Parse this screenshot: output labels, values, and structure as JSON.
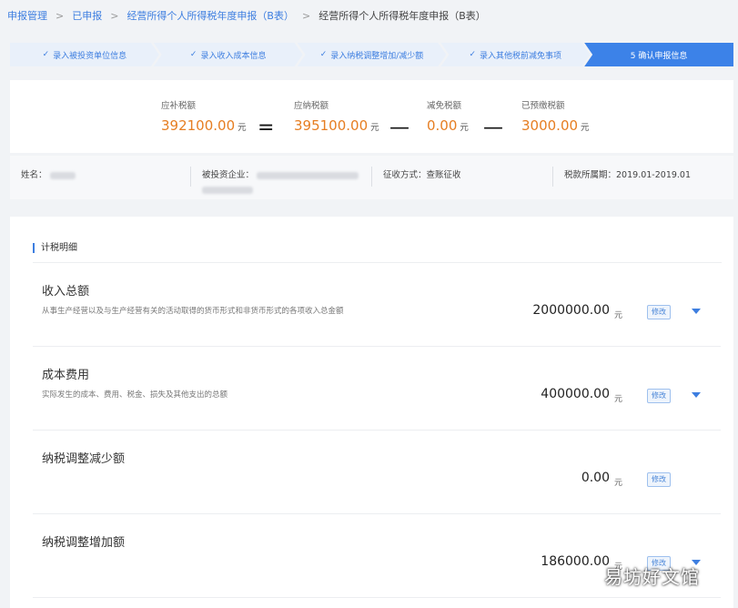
{
  "breadcrumb": {
    "items": [
      "申报管理",
      "已申报",
      "经营所得个人所得税年度申报（B表）",
      "经营所得个人所得税年度申报（B表）"
    ]
  },
  "steps": [
    {
      "label": "录入被投资单位信息",
      "done": true
    },
    {
      "label": "录入收入成本信息",
      "done": true
    },
    {
      "label": "录入纳税调整增加/减少额",
      "done": true
    },
    {
      "label": "录入其他税前减免事项",
      "done": true
    },
    {
      "label": "5 确认申报信息",
      "done": false,
      "active": true
    }
  ],
  "summary": {
    "unit": "元",
    "items": [
      {
        "label": "应补税额",
        "value": "392100.00"
      },
      {
        "label": "应纳税额",
        "value": "395100.00"
      },
      {
        "label": "减免税额",
        "value": "0.00"
      },
      {
        "label": "已预缴税额",
        "value": "3000.00"
      }
    ],
    "operators": [
      "=",
      "—",
      "—"
    ]
  },
  "info": {
    "name_label": "姓名：",
    "enterprise_label": "被投资企业：",
    "collection_label": "征收方式：",
    "collection_value": "查账征收",
    "period_label": "税款所属期：",
    "period_value": "2019.01-2019.01"
  },
  "detail": {
    "section_title": "计税明细",
    "unit": "元",
    "edit_label": "修改",
    "rows": [
      {
        "title": "收入总额",
        "desc": "从事生产经营以及与生产经营有关的活动取得的货币形式和非货币形式的各项收入总金额",
        "amount": "2000000.00",
        "expandable": true
      },
      {
        "title": "成本费用",
        "desc": "实际发生的成本、费用、税金、损失及其他支出的总额",
        "amount": "400000.00",
        "expandable": true
      },
      {
        "title": "纳税调整减少额",
        "desc": "",
        "amount": "0.00",
        "expandable": false
      },
      {
        "title": "纳税调整增加额",
        "desc": "",
        "amount": "186000.00",
        "expandable": true
      }
    ]
  },
  "watermark": "易坊好文馆",
  "colors": {
    "accent": "#3d7ee0",
    "amount_orange": "#e67e22",
    "active_step": "#3c82e8"
  }
}
